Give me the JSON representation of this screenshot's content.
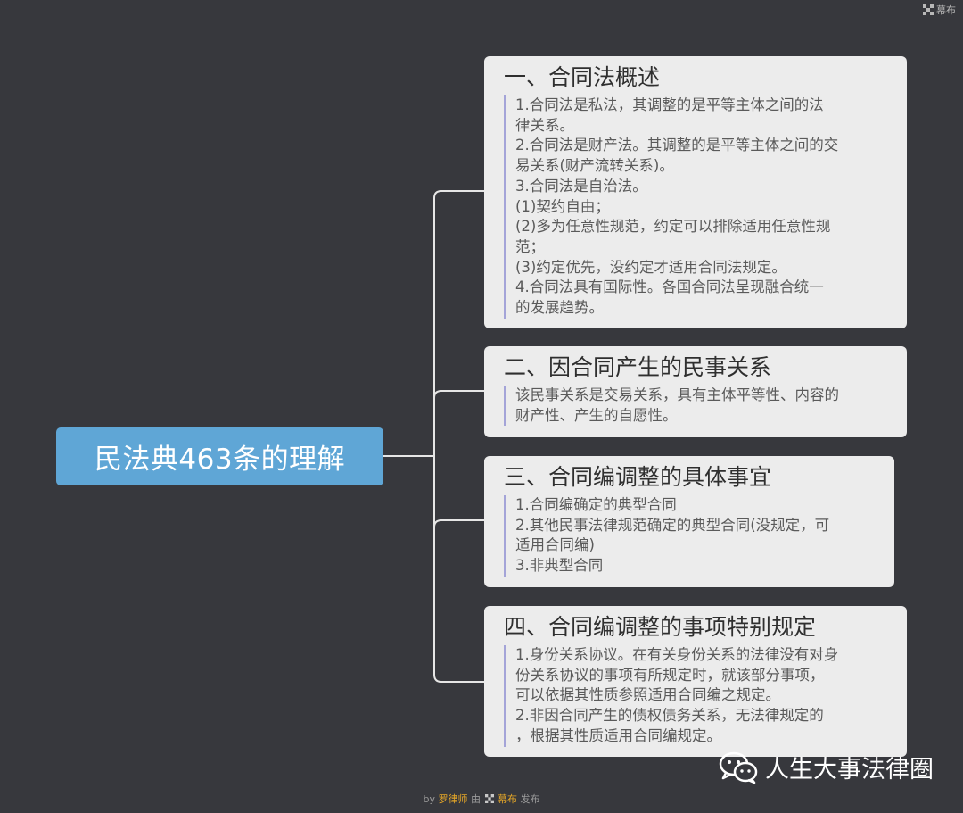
{
  "brand": {
    "label": "幕布"
  },
  "root": {
    "title": "民法典463条的理解"
  },
  "branches": [
    {
      "title": "一、合同法概述",
      "notes": [
        "1.合同法是私法，其调整的是平等主体之间的法",
        "律关系。",
        "2.合同法是财产法。其调整的是平等主体之间的交",
        "易关系(财产流转关系)。",
        "3.合同法是自治法。",
        "(1)契约自由；",
        "(2)多为任意性规范，约定可以排除适用任意性规",
        "范；",
        "(3)约定优先，没约定才适用合同法规定。",
        "4.合同法具有国际性。各国合同法呈现融合统一",
        "的发展趋势。"
      ]
    },
    {
      "title": "二、因合同产生的民事关系",
      "notes": [
        "该民事关系是交易关系，具有主体平等性、内容的",
        "财产性、产生的自愿性。"
      ]
    },
    {
      "title": "三、合同编调整的具体事宜",
      "notes": [
        "1.合同编确定的典型合同",
        "2.其他民事法律规范确定的典型合同(没规定，可",
        "适用合同编)",
        "3.非典型合同"
      ]
    },
    {
      "title": "四、合同编调整的事项特别规定",
      "notes": [
        "1.身份关系协议。在有关身份关系的法律没有对身",
        "份关系协议的事项有所规定时，就该部分事项，",
        "可以依据其性质参照适用合同编之规定。",
        "2.非因合同产生的债权债务关系，无法律规定的",
        "，根据其性质适用合同编规定。"
      ]
    }
  ],
  "footer": {
    "by": "by",
    "author": "罗律师",
    "via": "由",
    "platform": "幕布",
    "published": "发布"
  },
  "watermark": {
    "text": "人生大事法律圈"
  },
  "colors": {
    "background": "#37383d",
    "root": "#5fa6d6",
    "node": "#ececec",
    "connector": "#e6e6e6",
    "note_bar": "#a4a4d8",
    "footer_highlight": "#e4a628"
  }
}
